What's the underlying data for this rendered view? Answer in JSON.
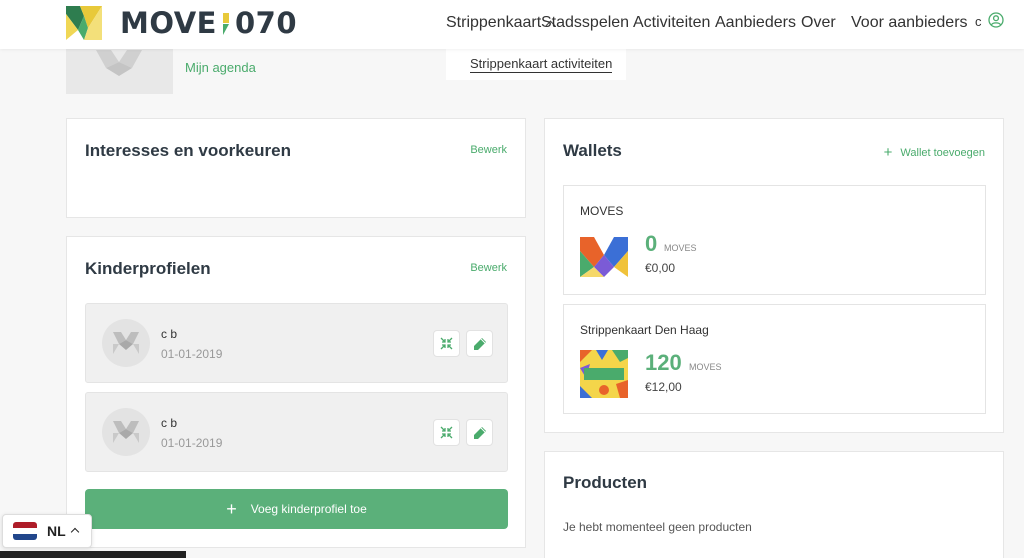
{
  "header": {
    "logo_text_left": "MOVE",
    "logo_text_right": "070",
    "nav": [
      {
        "label": "Strippenkaart"
      },
      {
        "label": "Stadsspelen"
      },
      {
        "label": "Activiteiten"
      },
      {
        "label": "Aanbieders"
      },
      {
        "label": "Over"
      },
      {
        "label": "Voor aanbieders"
      }
    ],
    "user_initial": "c",
    "dropdown_item": "Strippenkaart activiteiten"
  },
  "profile": {
    "agenda_link": "Mijn agenda"
  },
  "interests": {
    "title": "Interesses en voorkeuren",
    "edit_label": "Bewerk"
  },
  "children": {
    "title": "Kinderprofielen",
    "edit_label": "Bewerk",
    "items": [
      {
        "name": "c b",
        "birthdate": "01-01-2019"
      },
      {
        "name": "c b",
        "birthdate": "01-01-2019"
      }
    ],
    "add_label": "Voeg kinderprofiel toe"
  },
  "wallets": {
    "title": "Wallets",
    "add_label": "Wallet toevoegen",
    "items": [
      {
        "name": "MOVES",
        "amount": "0",
        "unit": "MOVES",
        "euro": "€0,00"
      },
      {
        "name": "Strippenkaart Den Haag",
        "amount": "120",
        "unit": "MOVES",
        "euro": "€12,00"
      }
    ]
  },
  "products": {
    "title": "Producten",
    "empty_text": "Je hebt momenteel geen producten"
  },
  "language": {
    "label": "NL"
  },
  "colors": {
    "brand_green": "#5bb07a",
    "link_green": "#4aab6c",
    "dark_text": "#2f3a44"
  }
}
